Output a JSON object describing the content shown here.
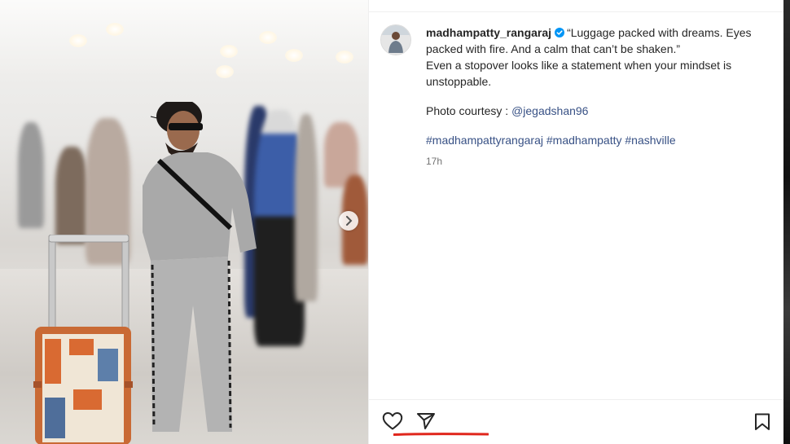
{
  "post": {
    "username": "madhampatty_rangaraj",
    "caption_lines": [
      "“Luggage packed with dreams. Eyes packed with fire. And a calm that can’t be shaken.”",
      "Even a stopover looks like a statement when your mindset is unstoppable."
    ],
    "credit_prefix": "Photo courtesy : ",
    "credit_mention": "@jegadshan96",
    "hashtags": [
      "#madhampattyrangaraj",
      "#madhampatty",
      "#nashville"
    ],
    "timestamp": "17h"
  },
  "icons": {
    "verified": "verified-badge-icon",
    "next": "chevron-right-icon",
    "like": "heart-icon",
    "share": "paper-plane-icon",
    "save": "bookmark-icon"
  },
  "colors": {
    "verified": "#0095f6",
    "link": "#385185",
    "annotation": "#e0261c"
  }
}
